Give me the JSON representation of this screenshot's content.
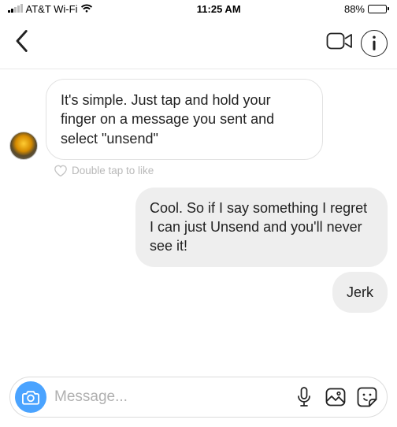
{
  "status": {
    "carrier": "AT&T Wi-Fi",
    "time": "11:25 AM",
    "battery_pct": "88%"
  },
  "messages": {
    "incoming1": "It's simple. Just tap and hold your finger on a message you sent and select \"unsend\"",
    "like_hint": "Double tap to like",
    "outgoing1": "Cool. So if I say something I regret I can just Unsend and you'll never see it!",
    "outgoing2": "Jerk"
  },
  "composer": {
    "placeholder": "Message..."
  }
}
